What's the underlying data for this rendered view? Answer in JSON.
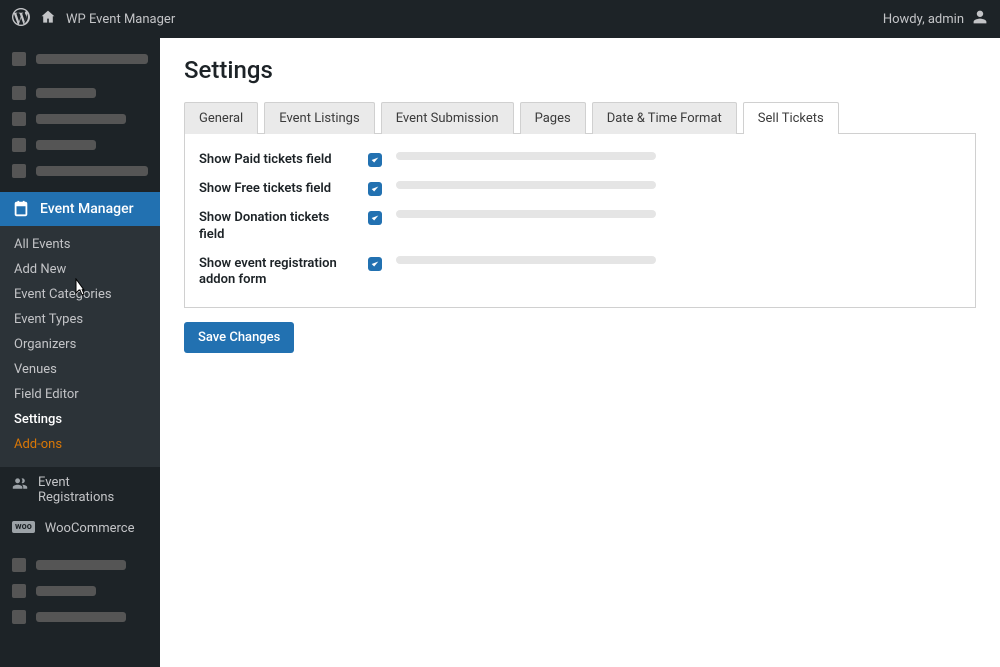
{
  "admin_bar": {
    "site_name": "WP Event Manager",
    "howdy": "Howdy, admin"
  },
  "sidebar": {
    "active_menu": "Event Manager",
    "submenu": [
      "All Events",
      "Add New",
      "Event Categories",
      "Event Types",
      "Organizers",
      "Venues",
      "Field Editor",
      "Settings",
      "Add-ons"
    ],
    "other_items": [
      "Event Registrations",
      "WooCommerce"
    ]
  },
  "page": {
    "title": "Settings",
    "tabs": [
      "General",
      "Event Listings",
      "Event Submission",
      "Pages",
      "Date & Time Format",
      "Sell Tickets"
    ],
    "fields": [
      "Show Paid tickets field",
      "Show Free tickets field",
      "Show Donation tickets field",
      "Show event registration addon form"
    ],
    "save_label": "Save Changes"
  }
}
